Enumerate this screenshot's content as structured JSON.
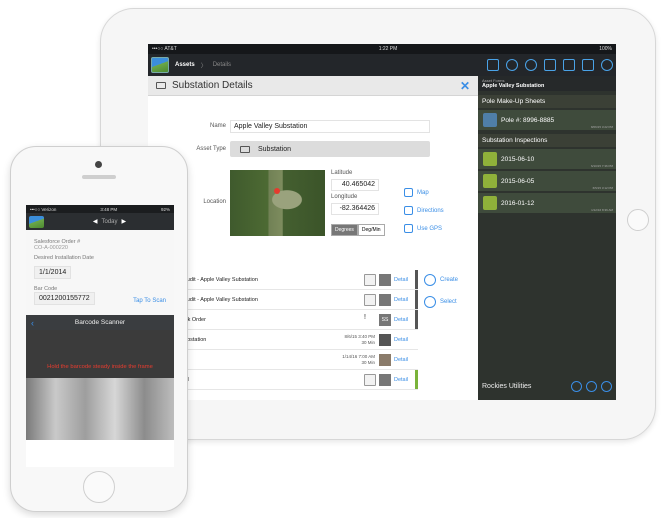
{
  "ipad": {
    "status": {
      "carrier": "•••○○ AT&T",
      "time": "1:22 PM",
      "battery": "100%"
    },
    "nav": {
      "crumb1": "Assets",
      "crumb2": "Details"
    },
    "details": {
      "title": "Substation Details",
      "name_label": "Name",
      "name_value": "Apple Valley Substation",
      "asset_type_label": "Asset Type",
      "asset_type_value": "Substation",
      "location_label": "Location",
      "latitude_label": "Latitude",
      "latitude_value": "40.465042",
      "longitude_label": "Longitude",
      "longitude_value": "-82.364426",
      "degrees": "Degrees",
      "degmin": "Deg/Min",
      "map_btn": "Map",
      "directions_btn": "Directions",
      "gps_btn": "Use GPS"
    },
    "rows": [
      {
        "text": "tion Audit  - Apple Valley Substation",
        "time": "",
        "detail": "Detail",
        "bar": "dark"
      },
      {
        "text": "tion Audit  - Apple Valley Substation",
        "time": "",
        "detail": "Detail",
        "bar": "dark"
      },
      {
        "text": "ir Work Order",
        "time": "",
        "detail": "Detail",
        "bar": "dark",
        "badge": "SS"
      },
      {
        "text": "ey Substation",
        "time": "8/6/15 3:40 PM\n30 Min",
        "detail": "Detail",
        "bar": "none"
      },
      {
        "text": "",
        "time": "1/14/16 7:00 AM\n30 Min",
        "detail": "Detail",
        "bar": "none"
      },
      {
        "text": "KMAN",
        "time": "",
        "detail": "Detail",
        "bar": "green"
      }
    ],
    "side_actions": {
      "create": "Create",
      "select": "Select"
    },
    "right_panel": {
      "head_small": "Asset Forms",
      "head_title": "Apple Valley Substation",
      "group1": "Pole Make-Up Sheets",
      "pole_item": "Pole #: 8996-8885",
      "pole_item_time": "8/06/15 3:22 PM",
      "group2": "Substation Inspections",
      "inspections": [
        {
          "date": "2015-06-10",
          "stamp": "6/10/15 7:36 PM"
        },
        {
          "date": "2015-06-05",
          "stamp": "6/5/15 3:12 PM"
        },
        {
          "date": "2016-01-12",
          "stamp": "1/12/16 8:36 AM"
        }
      ],
      "footer": "Rockies Utilities"
    }
  },
  "iphone": {
    "status": {
      "carrier": "•••○○ Verizon",
      "time": "3:48 PM",
      "battery": "92%"
    },
    "nav": {
      "today": "Today",
      "prev": "◀",
      "next": "▶"
    },
    "salesforce_label": "Salesforce Order #",
    "salesforce_value": "CO-A-000220",
    "install_label": "Desired Installation Date",
    "install_value": "1/1/2014",
    "barcode_label": "Bar Code",
    "barcode_value": "0021200155772",
    "tap_to_scan": "Tap To Scan",
    "scanner_title": "Barcode Scanner",
    "scanner_msg": "Hold the barcode steady inside the frame"
  },
  "colors": {
    "accent": "#3a8ee6",
    "alert": "#e83c2f",
    "panel": "#2e332e"
  }
}
